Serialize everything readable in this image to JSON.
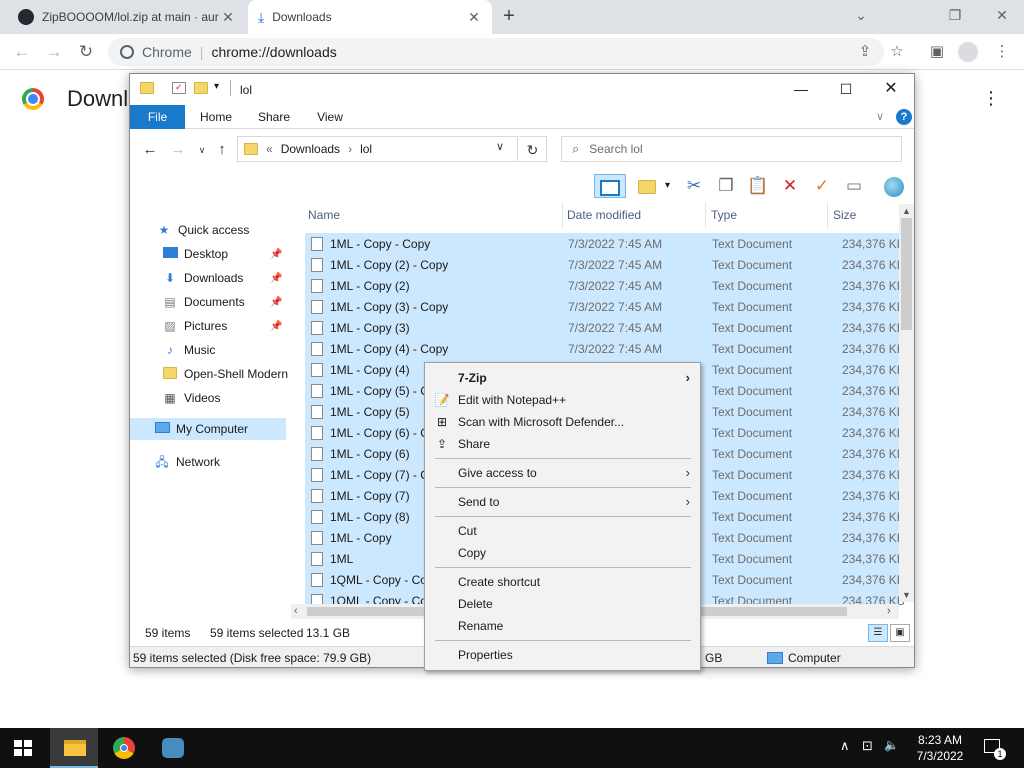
{
  "chrome": {
    "tabs": [
      {
        "title": "ZipBOOOOM/lol.zip at main · aur",
        "close": "✕"
      },
      {
        "title": "Downloads",
        "close": "✕"
      }
    ],
    "new_tab": "+",
    "window_controls": {
      "minimize": "⌄",
      "restore": "❐",
      "close": "✕"
    },
    "omnibox": {
      "site_label": "Chrome",
      "separator": "|",
      "url": "chrome://downloads"
    },
    "page_title": "Downloads",
    "menu_glyph": "⋮"
  },
  "explorer": {
    "title": "lol",
    "ribbon_tabs": [
      "File",
      "Home",
      "Share",
      "View"
    ],
    "help": "?",
    "address": {
      "prefix": "«",
      "crumbs": [
        "Downloads",
        "lol"
      ],
      "separator": "›"
    },
    "search_placeholder": "Search lol",
    "nav_pane": [
      {
        "label": "Quick access",
        "icon": "star-icon"
      },
      {
        "label": "Desktop",
        "icon": "desktop-icon",
        "pinned": true
      },
      {
        "label": "Downloads",
        "icon": "download-icon",
        "pinned": true
      },
      {
        "label": "Documents",
        "icon": "documents-icon",
        "pinned": true
      },
      {
        "label": "Pictures",
        "icon": "pictures-icon",
        "pinned": true
      },
      {
        "label": "Music",
        "icon": "music-icon"
      },
      {
        "label": "Open-Shell Modern",
        "icon": "folder-icon"
      },
      {
        "label": "Videos",
        "icon": "videos-icon"
      },
      {
        "label": "My Computer",
        "icon": "computer-icon",
        "selected": true
      },
      {
        "label": "Network",
        "icon": "network-icon"
      }
    ],
    "columns": [
      "Name",
      "Date modified",
      "Type",
      "Size"
    ],
    "files": [
      {
        "name": "1ML - Copy - Copy",
        "date": "7/3/2022 7:45 AM",
        "type": "Text Document",
        "size": "234,376 KB"
      },
      {
        "name": "1ML - Copy (2) - Copy",
        "date": "7/3/2022 7:45 AM",
        "type": "Text Document",
        "size": "234,376 KB"
      },
      {
        "name": "1ML - Copy (2)",
        "date": "7/3/2022 7:45 AM",
        "type": "Text Document",
        "size": "234,376 KB"
      },
      {
        "name": "1ML - Copy (3) - Copy",
        "date": "7/3/2022 7:45 AM",
        "type": "Text Document",
        "size": "234,376 KB"
      },
      {
        "name": "1ML - Copy (3)",
        "date": "7/3/2022 7:45 AM",
        "type": "Text Document",
        "size": "234,376 KB"
      },
      {
        "name": "1ML - Copy (4) - Copy",
        "date": "7/3/2022 7:45 AM",
        "type": "Text Document",
        "size": "234,376 KB"
      },
      {
        "name": "1ML - Copy (4)",
        "date": "",
        "type": "Text Document",
        "size": "234,376 KB"
      },
      {
        "name": "1ML - Copy (5) - C",
        "date": "",
        "type": "Text Document",
        "size": "234,376 KB"
      },
      {
        "name": "1ML - Copy (5)",
        "date": "",
        "type": "Text Document",
        "size": "234,376 KB"
      },
      {
        "name": "1ML - Copy (6) - C",
        "date": "",
        "type": "Text Document",
        "size": "234,376 KB"
      },
      {
        "name": "1ML - Copy (6)",
        "date": "",
        "type": "Text Document",
        "size": "234,376 KB"
      },
      {
        "name": "1ML - Copy (7) - C",
        "date": "",
        "type": "Text Document",
        "size": "234,376 KB"
      },
      {
        "name": "1ML - Copy (7)",
        "date": "",
        "type": "Text Document",
        "size": "234,376 KB"
      },
      {
        "name": "1ML - Copy (8)",
        "date": "",
        "type": "Text Document",
        "size": "234,376 KB"
      },
      {
        "name": "1ML - Copy",
        "date": "",
        "type": "Text Document",
        "size": "234,376 KB"
      },
      {
        "name": "1ML",
        "date": "",
        "type": "Text Document",
        "size": "234,376 KB"
      },
      {
        "name": "1QML - Copy - Co",
        "date": "",
        "type": "Text Document",
        "size": "234,376 KB"
      },
      {
        "name": "1QML - Copy - Co",
        "date": "",
        "type": "Text Document",
        "size": "234,376 KB"
      }
    ],
    "status": {
      "count": "59 items",
      "selected": "59 items selected",
      "size": "13.1 GB"
    },
    "footer": {
      "left": "59 items selected (Disk free space: 79.9 GB)",
      "mid": "GB",
      "right": "Computer"
    }
  },
  "context_menu": {
    "groups": [
      [
        {
          "label": "7-Zip",
          "bold": true,
          "submenu": true,
          "icon": ""
        },
        {
          "label": "Edit with Notepad++",
          "icon": "notepadpp-icon"
        },
        {
          "label": "Scan with Microsoft Defender...",
          "icon": "defender-icon"
        },
        {
          "label": "Share",
          "icon": "share-icon"
        }
      ],
      [
        {
          "label": "Give access to",
          "submenu": true
        }
      ],
      [
        {
          "label": "Send to",
          "submenu": true
        }
      ],
      [
        {
          "label": "Cut"
        },
        {
          "label": "Copy"
        }
      ],
      [
        {
          "label": "Create shortcut"
        },
        {
          "label": "Delete"
        },
        {
          "label": "Rename"
        }
      ],
      [
        {
          "label": "Properties"
        }
      ]
    ],
    "submenu_glyph": "›"
  },
  "taskbar": {
    "clock_time": "8:23 AM",
    "clock_date": "7/3/2022",
    "tray_glyphs": {
      "chevron": "∧",
      "network": "⊡",
      "volume": "🔈"
    },
    "notification_count": "1"
  },
  "colors": {
    "accent": "#1979ca",
    "selection": "#cce8ff",
    "delete_red": "#d32020",
    "check_orange": "#e07b20"
  }
}
